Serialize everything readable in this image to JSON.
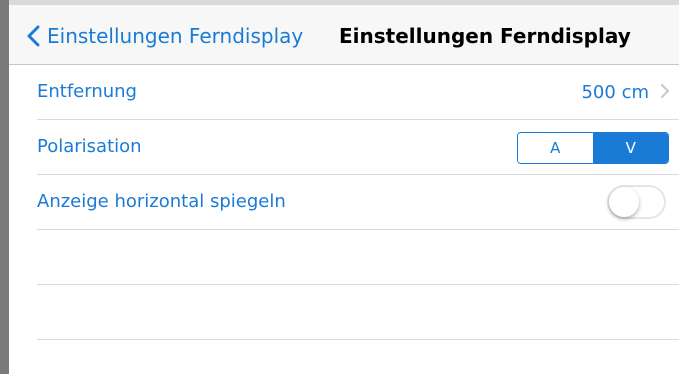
{
  "colors": {
    "accent": "#1a7bd6",
    "separator": "#d9d9de",
    "navbar_bg": "#f7f7f7",
    "toggle_off_border": "#e5e5ea"
  },
  "navbar": {
    "back_label": "Einstellungen Ferndisplay",
    "back_icon": "chevron-left-icon",
    "title": "Einstellungen Ferndisplay"
  },
  "settings": {
    "distance": {
      "label": "Entfernung",
      "value": "500 cm",
      "icon": "chevron-right-icon"
    },
    "polarisation": {
      "label": "Polarisation",
      "options": [
        "A",
        "V"
      ],
      "selected": "V"
    },
    "mirror": {
      "label": "Anzeige horizontal spiegeln",
      "enabled": false
    }
  }
}
